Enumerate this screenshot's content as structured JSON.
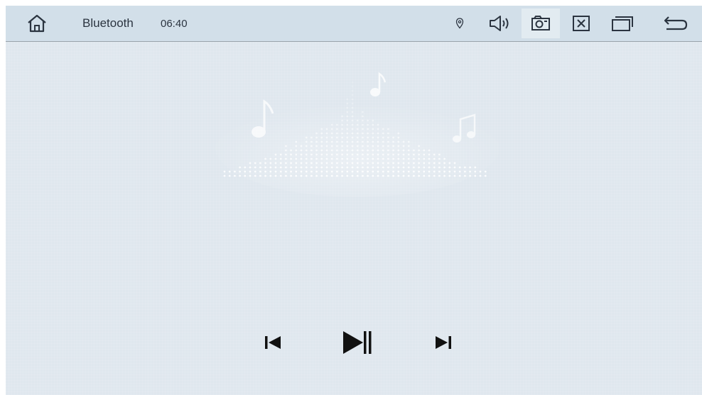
{
  "statusbar": {
    "title": "Bluetooth",
    "time": "06:40",
    "icons": [
      "home-icon",
      "location-icon",
      "volume-icon",
      "screenshot-icon",
      "close-icon",
      "windows-icon",
      "back-icon"
    ]
  },
  "player": {
    "controls": [
      "previous-icon",
      "play-pause-icon",
      "next-icon"
    ]
  },
  "colors": {
    "statusbar_bg": "#d2dfe9",
    "screen_bg": "#dfe7ee",
    "icon": "#2b3440",
    "control": "#111111"
  }
}
